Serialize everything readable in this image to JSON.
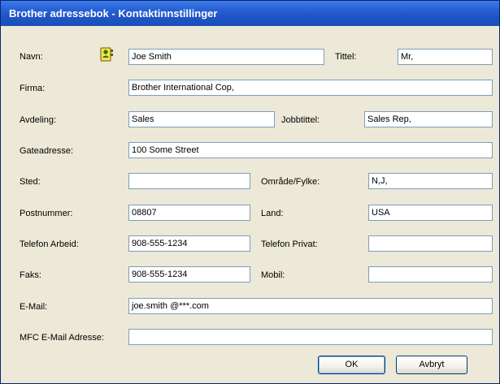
{
  "window": {
    "title": "Brother adressebok - Kontaktinnstillinger"
  },
  "labels": {
    "name": "Navn:",
    "title": "Tittel:",
    "company": "Firma:",
    "department": "Avdeling:",
    "job_title": "Jobbtittel:",
    "street": "Gateadresse:",
    "city": "Sted:",
    "state": "Område/Fylke:",
    "zip": "Postnummer:",
    "country": "Land:",
    "work_phone": "Telefon Arbeid:",
    "home_phone": "Telefon Privat:",
    "fax": "Faks:",
    "mobile": "Mobil:",
    "email": "E-Mail:",
    "mfc_email": "MFC E-Mail Adresse:"
  },
  "values": {
    "name": "Joe Smith",
    "title": "Mr,",
    "company": "Brother International Cop,",
    "department": "Sales",
    "job_title": "Sales Rep,",
    "street": "100 Some Street",
    "city": "",
    "state": "N,J,",
    "zip": "08807",
    "country": "USA",
    "work_phone": "908-555-1234",
    "home_phone": "",
    "fax": "908-555-1234",
    "mobile": "",
    "email": "joe.smith @***.com",
    "mfc_email": ""
  },
  "buttons": {
    "ok": "OK",
    "cancel": "Avbryt"
  },
  "icons": {
    "contact": "contact-card-icon"
  }
}
